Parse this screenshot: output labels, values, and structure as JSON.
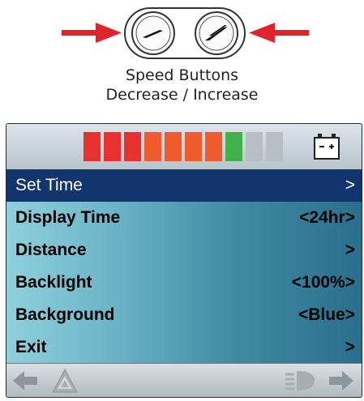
{
  "speed_buttons": {
    "caption_line1": "Speed Buttons",
    "caption_line2": "Decrease / Increase",
    "decrease_icon": "speed-decrease-icon",
    "increase_icon": "speed-increase-icon",
    "arrow_color": "#e0242d"
  },
  "display": {
    "speed_bar": {
      "segment_colors": [
        "#e8302e",
        "#e8302e",
        "#e8302e",
        "#ef5b2a",
        "#ef5b2a",
        "#ef5b2a",
        "#ef5b2a",
        "#3fb24a",
        "#b8bec3",
        "#b8bec3"
      ],
      "lit_segments": 8,
      "total_segments": 10
    },
    "battery_icon": "battery-icon",
    "menu": [
      {
        "label": "Set Time",
        "value": ">",
        "selected": true
      },
      {
        "label": "Display Time",
        "value": "<24hr>",
        "selected": false
      },
      {
        "label": "Distance",
        "value": ">",
        "selected": false
      },
      {
        "label": "Backlight",
        "value": "<100%>",
        "selected": false
      },
      {
        "label": "Background",
        "value": "<Blue>",
        "selected": false
      },
      {
        "label": "Exit",
        "value": ">",
        "selected": false
      }
    ],
    "bottom_icons": [
      "left-arrow-icon",
      "hazard-triangle-icon",
      "headlight-icon",
      "right-arrow-icon"
    ],
    "selection_color": "#13356d"
  }
}
